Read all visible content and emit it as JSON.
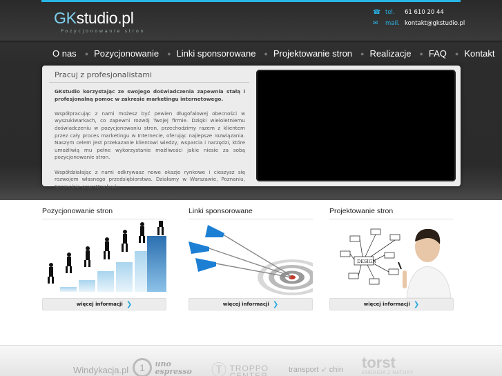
{
  "header": {
    "brand_gk": "GK",
    "brand_rest": "studio.pl",
    "tagline": "Pozycjonowanie stron",
    "contact": {
      "phone_label": "tel.",
      "phone": "61 610 20 44",
      "mail_label": "mail.",
      "mail": "kontakt@gkstudio.pl"
    }
  },
  "nav": [
    "O nas",
    "Pozycjonowanie",
    "Linki sponsorowane",
    "Projektowanie stron",
    "Realizacje",
    "FAQ",
    "Kontakt"
  ],
  "hero": {
    "title": "Pracuj z profesjonalistami",
    "lead": "GKstudio korzystając ze swojego doświadczenia zapewnia stałą i profesjonalną pomoc w zakresie marketingu internetowego.",
    "p1": "Współpracując z nami możesz być pewien długofalowej obecności w wyszukiwarkach, co zapewni rozwój Twojej firmie. Dzięki wieloletniemu doświadczeniu w pozycjonowaniu stron, przechodzimy razem z klientem przez cały proces marketingu w Internecie, oferując najlepsze rozwiązania. Naszym celem jest przekazanie klientowi wiedzy, wsparcia i narzędzi, które umożliwią mu pełne wykorzystanie możliwości jakie niesie za sobą pozycjonowanie stron.",
    "p2": "Współdziałając z nami odkrywasz nowe okazje rynkowe i cieszysz się rozwojem własnego przedsiębiorstwa. Działamy w Warszawie, Poznaniu, Szczecinie oraz Wrocławiu"
  },
  "columns": [
    {
      "title": "Pozycjonowanie stron",
      "button": "więcej informacji"
    },
    {
      "title": "Linki sponsorowane",
      "button": "więcej informacji"
    },
    {
      "title": "Projektowanie stron",
      "button": "więcej informacji"
    }
  ],
  "diagram_labels": [
    "DESIGN"
  ],
  "partners": [
    "Windykacja.pl",
    "uno espresso",
    "TROPPO CENTER",
    "transport",
    "chin",
    "torst",
    "ENERGIA Z NATURY"
  ],
  "colors": {
    "accent": "#28b6e6",
    "header_bg": "#2c2c2c",
    "panel_bg": "#ececec"
  }
}
